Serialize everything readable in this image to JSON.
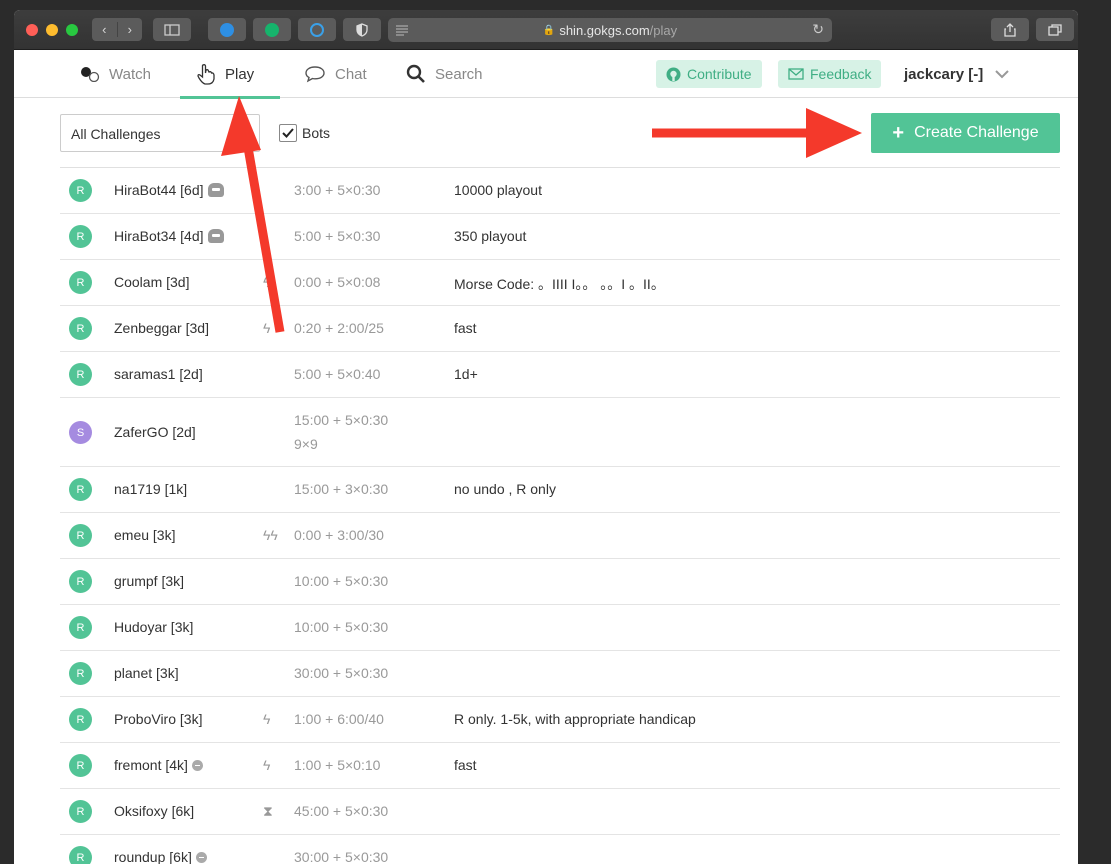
{
  "browser": {
    "url_host": "shin.gokgs.com",
    "url_path": "/play"
  },
  "nav": {
    "watch": "Watch",
    "play": "Play",
    "chat": "Chat",
    "search": "Search",
    "contribute": "Contribute",
    "feedback": "Feedback",
    "user": "jackcary [-]"
  },
  "filters": {
    "select_value": "All Challenges",
    "bots_label": "Bots",
    "bots_checked": true,
    "create_label": "Create Challenge"
  },
  "challenges": [
    {
      "avatar": "R",
      "player": "HiraBot44 [6d]",
      "marker": "bot-icon",
      "speed": "",
      "time": "3:00 + 5×0:30",
      "time2": "",
      "note": "10000 playout"
    },
    {
      "avatar": "R",
      "player": "HiraBot34 [4d]",
      "marker": "bot-icon",
      "speed": "",
      "time": "5:00 + 5×0:30",
      "time2": "",
      "note": "350 playout"
    },
    {
      "avatar": "R",
      "player": "Coolam [3d]",
      "marker": "",
      "speed": "ϟ",
      "time": "0:00 + 5×0:08",
      "time2": "",
      "note": "Morse Code: 。IIII I。。 。。I 。II。"
    },
    {
      "avatar": "R",
      "player": "Zenbeggar [3d]",
      "marker": "",
      "speed": "ϟ",
      "time": "0:20 + 2:00/25",
      "time2": "",
      "note": "fast"
    },
    {
      "avatar": "R",
      "player": "saramas1 [2d]",
      "marker": "",
      "speed": "",
      "time": "5:00 + 5×0:40",
      "time2": "",
      "note": "1d+"
    },
    {
      "avatar": "S",
      "player": "ZaferGO [2d]",
      "marker": "",
      "speed": "",
      "time": "15:00 + 5×0:30",
      "time2": "9×9",
      "note": ""
    },
    {
      "avatar": "R",
      "player": "na1719 [1k]",
      "marker": "",
      "speed": "",
      "time": "15:00 + 3×0:30",
      "time2": "",
      "note": "no undo , R only"
    },
    {
      "avatar": "R",
      "player": "emeu [3k]",
      "marker": "",
      "speed": "ϟϟ",
      "time": "0:00 + 3:00/30",
      "time2": "",
      "note": ""
    },
    {
      "avatar": "R",
      "player": "grumpf [3k]",
      "marker": "",
      "speed": "",
      "time": "10:00 + 5×0:30",
      "time2": "",
      "note": ""
    },
    {
      "avatar": "R",
      "player": "Hudoyar [3k]",
      "marker": "",
      "speed": "",
      "time": "10:00 + 5×0:30",
      "time2": "",
      "note": ""
    },
    {
      "avatar": "R",
      "player": "planet [3k]",
      "marker": "",
      "speed": "",
      "time": "30:00 + 5×0:30",
      "time2": "",
      "note": ""
    },
    {
      "avatar": "R",
      "player": "ProboViro [3k]",
      "marker": "",
      "speed": "ϟ",
      "time": "1:00 + 6:00/40",
      "time2": "",
      "note": "R only. 1-5k, with appropriate handicap"
    },
    {
      "avatar": "R",
      "player": "fremont [4k]",
      "marker": "gray-dot",
      "speed": "ϟ",
      "time": "1:00 + 5×0:10",
      "time2": "",
      "note": "fast"
    },
    {
      "avatar": "R",
      "player": "Oksifoxy [6k]",
      "marker": "",
      "speed": "⧗",
      "time": "45:00 + 5×0:30",
      "time2": "",
      "note": ""
    },
    {
      "avatar": "R",
      "player": "roundup [6k]",
      "marker": "gray-dot",
      "speed": "",
      "time": "30:00 + 5×0:30",
      "time2": "",
      "note": ""
    }
  ],
  "colors": {
    "accent": "#52c496",
    "accent_light": "#d7f2e6",
    "purple": "#a58be0",
    "arrow": "#f4392b"
  }
}
